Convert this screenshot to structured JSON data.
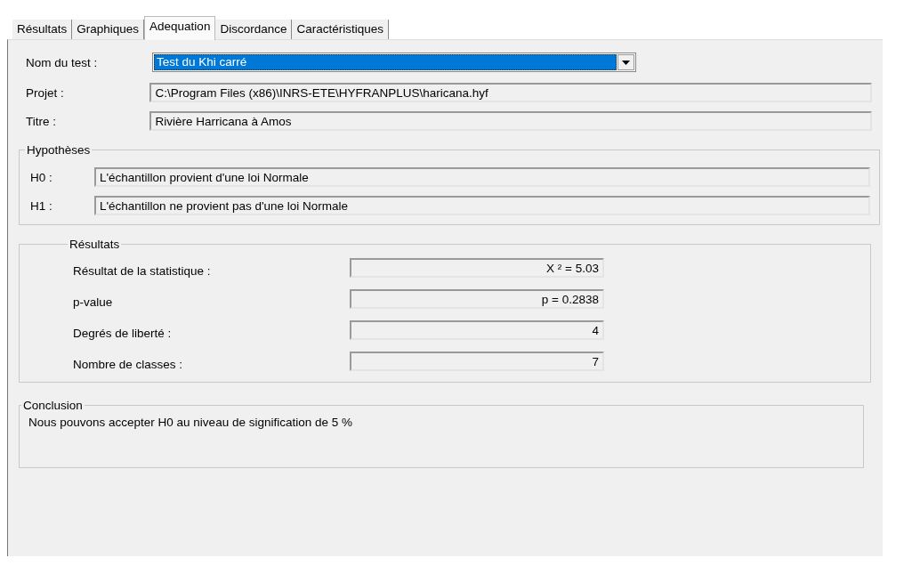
{
  "tabs": [
    {
      "label": "Résultats",
      "selected": false
    },
    {
      "label": "Graphiques",
      "selected": false
    },
    {
      "label": "Adequation",
      "selected": true
    },
    {
      "label": "Discordance",
      "selected": false
    },
    {
      "label": "Caractéristiques",
      "selected": false
    }
  ],
  "test": {
    "label": "Nom du test :",
    "value": "Test du Khi carré"
  },
  "project": {
    "label": "Projet :",
    "value": "C:\\Program Files (x86)\\INRS-ETE\\HYFRANPLUS\\haricana.hyf"
  },
  "title": {
    "label": "Titre :",
    "value": "Rivière Harricana à Amos"
  },
  "hypotheses": {
    "title": "Hypothèses",
    "items": [
      {
        "label": "H0 :",
        "value": "L'échantillon provient d'une loi Normale"
      },
      {
        "label": "H1 :",
        "value": "L'échantillon ne provient pas d'une loi Normale"
      }
    ]
  },
  "results": {
    "title": "Résultats",
    "rows": [
      {
        "label": "Résultat de la statistique :",
        "value": "X ² = 5.03"
      },
      {
        "label": "p-value",
        "value": "p = 0.2838"
      },
      {
        "label": "Degrés de liberté :",
        "value": "4"
      },
      {
        "label": "Nombre de classes :",
        "value": "7"
      }
    ]
  },
  "conclusion": {
    "title": "Conclusion",
    "text": "Nous pouvons accepter H0 au niveau de signification de 5 %"
  }
}
